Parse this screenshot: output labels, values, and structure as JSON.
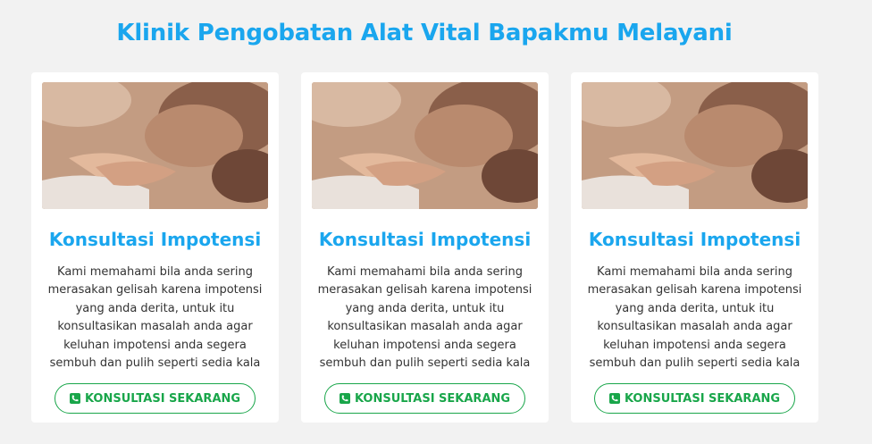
{
  "header": {
    "title": "Klinik Pengobatan Alat Vital Bapakmu Melayani"
  },
  "cards": [
    {
      "image_alt": "couple-holding-hands-photo",
      "title": "Konsultasi Impotensi",
      "text": "Kami memahami bila anda sering merasakan gelisah karena impotensi yang anda derita, untuk itu konsultasikan masalah anda agar keluhan impotensi anda segera sembuh dan pulih seperti sedia kala",
      "button_label": "KONSULTASI SEKARANG",
      "button_icon": "phone-square-icon"
    },
    {
      "image_alt": "couple-holding-hands-photo",
      "title": "Konsultasi Impotensi",
      "text": "Kami memahami bila anda sering merasakan gelisah karena impotensi yang anda derita, untuk itu konsultasikan masalah anda agar keluhan impotensi anda segera sembuh dan pulih seperti sedia kala",
      "button_label": "KONSULTASI SEKARANG",
      "button_icon": "phone-square-icon"
    },
    {
      "image_alt": "couple-holding-hands-photo",
      "title": "Konsultasi Impotensi",
      "text": "Kami memahami bila anda sering merasakan gelisah karena impotensi yang anda derita, untuk itu konsultasikan masalah anda agar keluhan impotensi anda segera sembuh dan pulih seperti sedia kala",
      "button_label": "KONSULTASI SEKARANG",
      "button_icon": "phone-square-icon"
    }
  ],
  "colors": {
    "accent_blue": "#1aa6ee",
    "button_green": "#19a64a",
    "background": "#f2f2f2",
    "card": "#ffffff"
  }
}
